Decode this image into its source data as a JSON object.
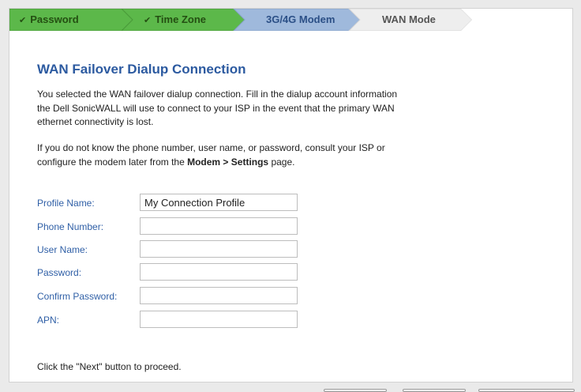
{
  "wizard": {
    "steps": [
      {
        "label": "Password",
        "state": "completed",
        "check": "✔"
      },
      {
        "label": "Time Zone",
        "state": "completed",
        "check": "✔"
      },
      {
        "label": "3G/4G Modem",
        "state": "active"
      },
      {
        "label": "WAN Mode",
        "state": "pending"
      }
    ],
    "colors": {
      "completed": "#5cb84a",
      "active": "#9fb9dc",
      "pending": "#eeeeee"
    }
  },
  "page": {
    "title": "WAN Failover Dialup Connection",
    "intro": "You selected the WAN failover dialup connection. Fill in the dialup account information the Dell SonicWALL will use to connect to your ISP in the event that the primary WAN ethernet connectivity is lost.",
    "help_prefix": "If you do not know the phone number, user name, or password, consult your ISP or configure the modem later from the ",
    "help_bold": "Modem > Settings",
    "help_suffix": " page.",
    "footer_note": "Click the \"Next\" button to proceed."
  },
  "form": {
    "profile_name": {
      "label": "Profile Name:",
      "value": "My Connection Profile"
    },
    "phone_number": {
      "label": "Phone Number:",
      "value": ""
    },
    "user_name": {
      "label": "User Name:",
      "value": ""
    },
    "password": {
      "label": "Password:",
      "value": ""
    },
    "confirm_password": {
      "label": "Confirm Password:",
      "value": ""
    },
    "apn": {
      "label": "APN:",
      "value": ""
    }
  },
  "colors": {
    "title": "#2c5aa0",
    "field_label": "#2f5fa6"
  }
}
